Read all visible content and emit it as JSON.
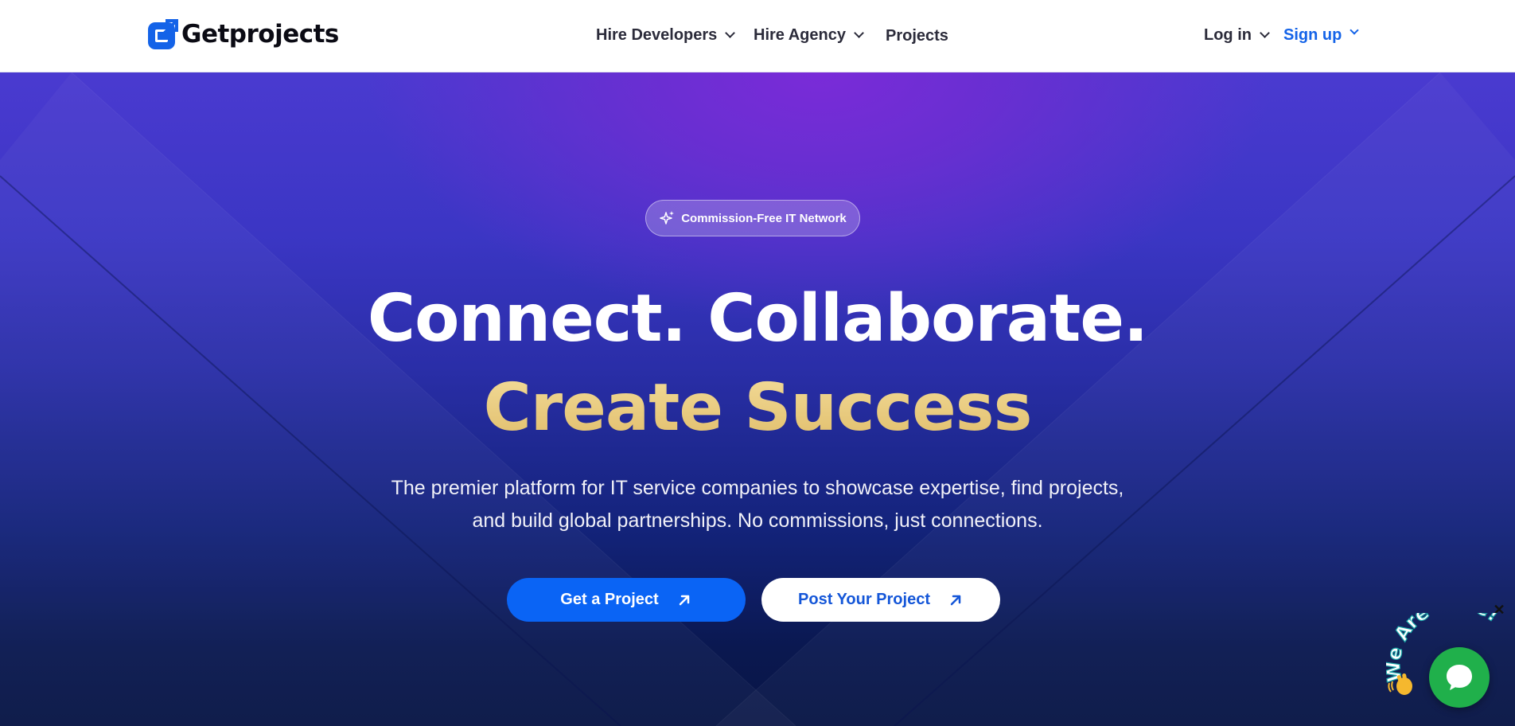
{
  "brand": {
    "name": "Getprojects"
  },
  "nav": {
    "items": [
      {
        "label": "Hire Developers",
        "has_dropdown": true
      },
      {
        "label": "Hire Agency",
        "has_dropdown": true
      },
      {
        "label": "Projects",
        "has_dropdown": false
      }
    ],
    "login": {
      "label": "Log in"
    },
    "signup": {
      "label": "Sign up"
    }
  },
  "hero": {
    "badge": "Commission-Free IT Network",
    "headline_line1": "Connect. Collaborate.",
    "headline_line2": "Create Success",
    "subtitle_line1": "The premier platform for IT service companies to showcase expertise, find projects,",
    "subtitle_line2": "and build global partnerships. No commissions, just connections.",
    "primary_cta": "Get a Project",
    "secondary_cta": "Post Your Project"
  },
  "chat_widget": {
    "badge_text": "We Are Here!",
    "close_label": "✕"
  },
  "colors": {
    "accent": "#0a64f5",
    "headline_gold": "#e8c97c",
    "chat_green": "#20b04b",
    "hero_top": "#7a2bd8",
    "hero_bottom": "#081545"
  },
  "icons": [
    "logo-icon",
    "chevron-down-icon",
    "sparkle-icon",
    "arrow-up-right-icon",
    "chat-icon",
    "close-icon",
    "wave-hand-icon"
  ]
}
